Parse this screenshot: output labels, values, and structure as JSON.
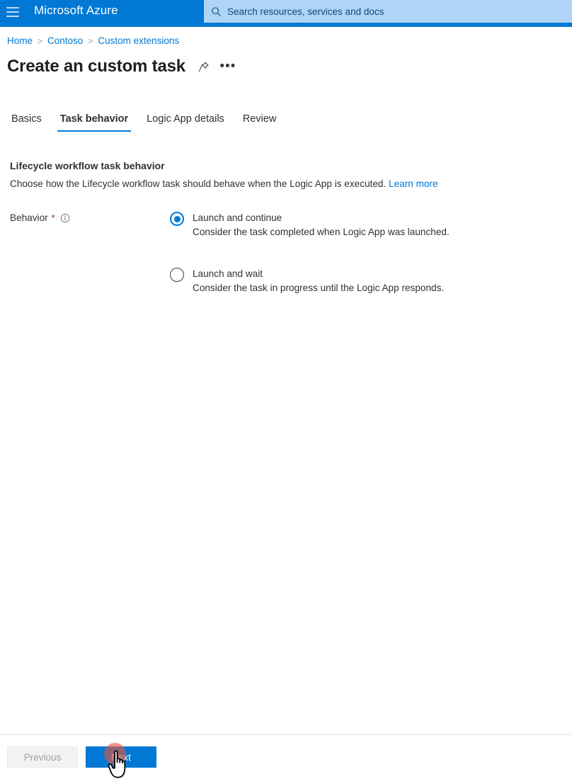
{
  "header": {
    "menu_icon": "hamburger-icon",
    "brand": "Microsoft Azure",
    "search": {
      "icon": "search-icon",
      "placeholder": "Search resources, services and docs"
    },
    "colors": {
      "bar": "#0078d4",
      "search_bg": "#aed5f5"
    }
  },
  "breadcrumb": {
    "separator": ">",
    "items": [
      {
        "label": "Home"
      },
      {
        "label": "Contoso"
      },
      {
        "label": "Custom extensions"
      }
    ]
  },
  "page": {
    "title": "Create an custom task",
    "pin_icon": "pin-icon",
    "more_icon": "ellipsis-icon",
    "more_glyph": "•••"
  },
  "tabs": [
    {
      "label": "Basics",
      "active": false
    },
    {
      "label": "Task behavior",
      "active": true
    },
    {
      "label": "Logic App details",
      "active": false
    },
    {
      "label": "Review",
      "active": false
    }
  ],
  "section": {
    "heading": "Lifecycle workflow task behavior",
    "description": "Choose how the Lifecycle workflow task should behave when the Logic App is executed.",
    "learn_more": "Learn more"
  },
  "field": {
    "label": "Behavior",
    "required_marker": "*",
    "info_icon": "info-icon",
    "options": [
      {
        "title": "Launch and continue",
        "description": "Consider the task completed when Logic App was launched.",
        "selected": true
      },
      {
        "title": "Launch and wait",
        "description": "Consider the task in progress until the Logic App responds.",
        "selected": false
      }
    ]
  },
  "footer": {
    "previous_label": "Previous",
    "next_label": "Next"
  },
  "pointer": {
    "cursor_icon": "hand-pointer-cursor",
    "click_marker_color": "#e8563e"
  }
}
